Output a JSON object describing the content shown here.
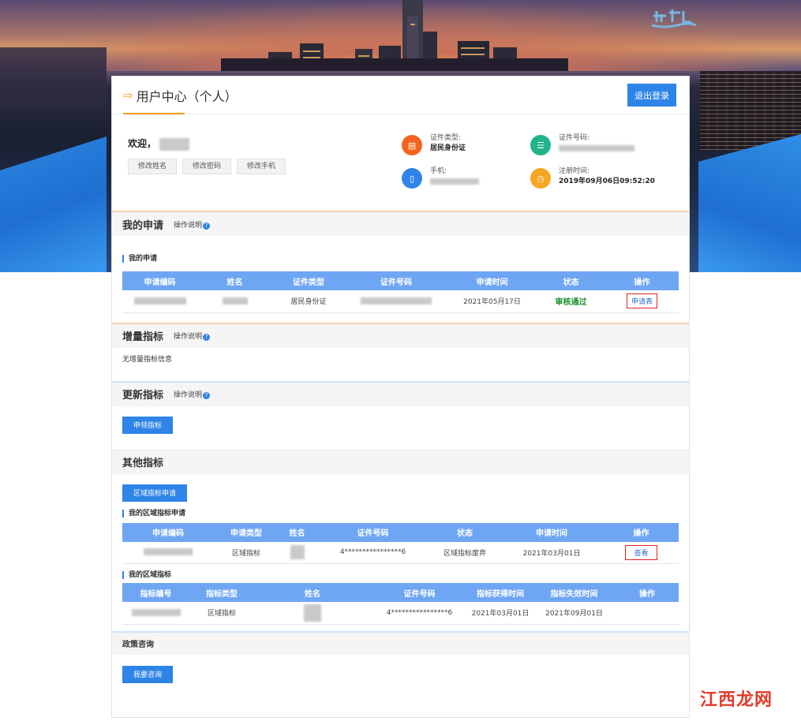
{
  "header": {
    "title": "用户中心（个人）",
    "logout_label": "退出登录"
  },
  "profile": {
    "welcome_label": "欢迎，",
    "buttons": [
      "修改姓名",
      "修改密码",
      "修改手机"
    ],
    "id_type_label": "证件类型:",
    "id_type_value": "居民身份证",
    "id_number_label": "证件号码:",
    "phone_label": "手机:",
    "reg_time_label": "注册时间:",
    "reg_time_value": "2019年09月06日09:52:20"
  },
  "my_application": {
    "title": "我的申请",
    "help_label": "操作说明",
    "sub_title": "我的申请",
    "columns": [
      "申请编码",
      "姓名",
      "证件类型",
      "证件号码",
      "申请时间",
      "状态",
      "操作"
    ],
    "rows": [
      {
        "id_type": "居民身份证",
        "date": "2021年05月17日",
        "status": "审核通过",
        "action": "申请表"
      }
    ]
  },
  "increment": {
    "title": "增量指标",
    "help_label": "操作说明",
    "empty_text": "无增量指标信息"
  },
  "renewal": {
    "title": "更新指标",
    "help_label": "操作说明",
    "button_label": "申领指标"
  },
  "other": {
    "title": "其他指标",
    "button_label": "区域指标申请",
    "regional_app_title": "我的区域指标申请",
    "regional_app_columns": [
      "申请编码",
      "申请类型",
      "姓名",
      "证件号码",
      "状态",
      "申请时间",
      "操作"
    ],
    "regional_app_rows": [
      {
        "type": "区域指标",
        "idno": "4****************6",
        "status": "区域指标废弃",
        "date": "2021年03月01日",
        "action": "查看"
      }
    ],
    "regional_title": "我的区域指标",
    "regional_columns": [
      "指标编号",
      "指标类型",
      "姓名",
      "证件号码",
      "指标获得时间",
      "指标失效时间",
      "操作"
    ],
    "regional_rows": [
      {
        "type": "区域指标",
        "idno": "4****************6",
        "obtained": "2021年03月01日",
        "expires": "2021年09月01日"
      }
    ]
  },
  "policy": {
    "title": "政策咨询",
    "button_label": "我要咨询"
  },
  "watermark": "江西龙网",
  "colors": {
    "primary_blue": "#2f84e8",
    "table_header": "#6fa6f3",
    "accent_orange": "#f29a1c",
    "status_green": "#1b8e2c",
    "highlight_red": "#e02020"
  }
}
